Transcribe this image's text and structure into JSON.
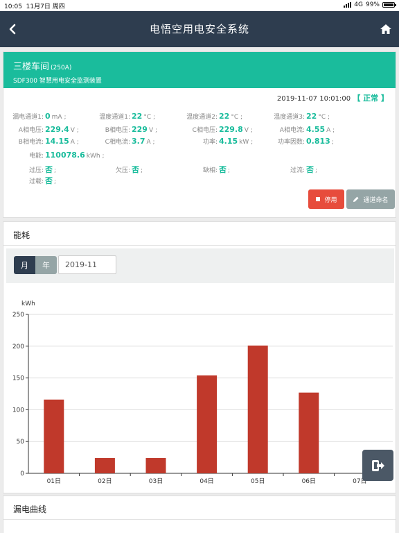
{
  "status": {
    "time": "10:05",
    "date": "11月7日 周四",
    "network": "4G",
    "battery": "99%"
  },
  "nav": {
    "title": "电悟空用电安全系统"
  },
  "device": {
    "name": "三楼车间",
    "capacity": "(250A)",
    "model": "SDF300 智慧用电安全监测装置",
    "timestamp": "2019-11-07 10:01:00",
    "state": "【 正常 】",
    "params": [
      {
        "label": "漏电通道1:",
        "value": "0",
        "unit": "mA ;"
      },
      {
        "label": "温度通道1:",
        "value": "22",
        "unit": "°C ;"
      },
      {
        "label": "温度通道2:",
        "value": "22",
        "unit": "°C ;"
      },
      {
        "label": "温度通道3:",
        "value": "22",
        "unit": "°C ;"
      },
      {
        "label": "A相电压:",
        "value": "229.4",
        "unit": "V ;"
      },
      {
        "label": "B相电压:",
        "value": "229",
        "unit": "V ;"
      },
      {
        "label": "C相电压:",
        "value": "229.8",
        "unit": "V ;"
      },
      {
        "label": "A相电流:",
        "value": "4.55",
        "unit": "A ;"
      },
      {
        "label": "B相电流:",
        "value": "14.15",
        "unit": "A ;"
      },
      {
        "label": "C相电流:",
        "value": "3.7",
        "unit": "A ;"
      },
      {
        "label": "功率:",
        "value": "4.15",
        "unit": "kW ;"
      },
      {
        "label": "功率因数:",
        "value": "0.813",
        "unit": ";"
      },
      {
        "label": "电能:",
        "value": "110078.6",
        "unit": "kWh ;"
      },
      {
        "label": "过压:",
        "value": "否",
        "unit": ";"
      },
      {
        "label": "欠压:",
        "value": "否",
        "unit": ";"
      },
      {
        "label": "缺相:",
        "value": "否",
        "unit": ";"
      },
      {
        "label": "过流:",
        "value": "否",
        "unit": ";"
      },
      {
        "label": "过载:",
        "value": "否",
        "unit": ";"
      }
    ],
    "stop_label": "停用",
    "rename_label": "通道命名"
  },
  "energy": {
    "title": "能耗",
    "tab_month": "月",
    "tab_year": "年",
    "date_value": "2019-11"
  },
  "chart_data": {
    "type": "bar",
    "ylabel": "kWh",
    "categories": [
      "01日",
      "02日",
      "03日",
      "04日",
      "05日",
      "06日",
      "07日"
    ],
    "values": [
      116,
      24,
      24,
      154,
      201,
      127,
      0
    ],
    "ylim": [
      0,
      250
    ],
    "yticks": [
      0,
      50,
      100,
      150,
      200,
      250
    ],
    "grid": true,
    "bar_color": "#c0392b"
  },
  "leak": {
    "title": "漏电曲线"
  },
  "colors": {
    "accent": "#1abc9c",
    "nav": "#2e3d4f",
    "danger": "#e74c3c"
  }
}
